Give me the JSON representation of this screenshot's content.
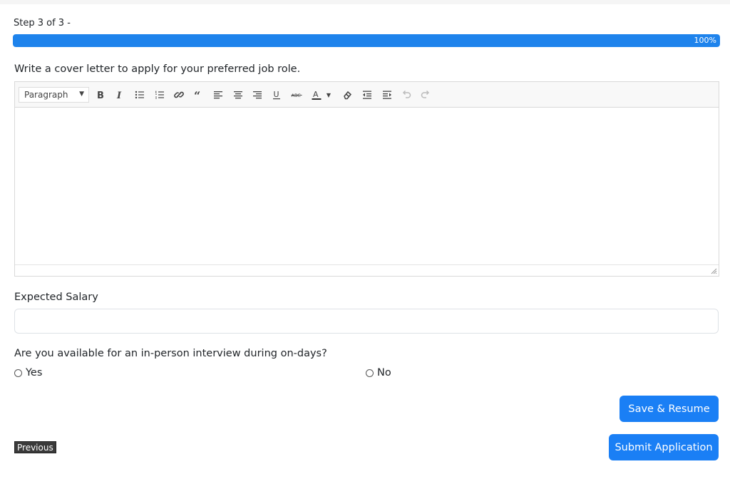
{
  "progress": {
    "step_text": "Step 3 of 3 -",
    "percent_label": "100%",
    "value": 1.0,
    "color": "#1e83ec"
  },
  "cover_letter": {
    "label": "Write a cover letter to apply for your preferred job role.",
    "format_select": "Paragraph",
    "toolbar_icons": [
      "bold-icon",
      "italic-icon",
      "bulleted-list-icon",
      "numbered-list-icon",
      "link-icon",
      "blockquote-icon",
      "align-left-icon",
      "align-center-icon",
      "align-right-icon",
      "underline-icon",
      "strikethrough-icon",
      "text-color-icon",
      "clear-format-icon",
      "outdent-icon",
      "indent-icon",
      "undo-icon",
      "redo-icon"
    ],
    "content": ""
  },
  "salary": {
    "label": "Expected Salary",
    "value": ""
  },
  "interview": {
    "question": "Are you available for an in-person interview during on-days?",
    "options": [
      "Yes",
      "No"
    ]
  },
  "actions": {
    "save_label": "Save & Resume",
    "submit_label": "Submit Application",
    "previous_label": "Previous",
    "button_color": "#1a7ff5"
  }
}
